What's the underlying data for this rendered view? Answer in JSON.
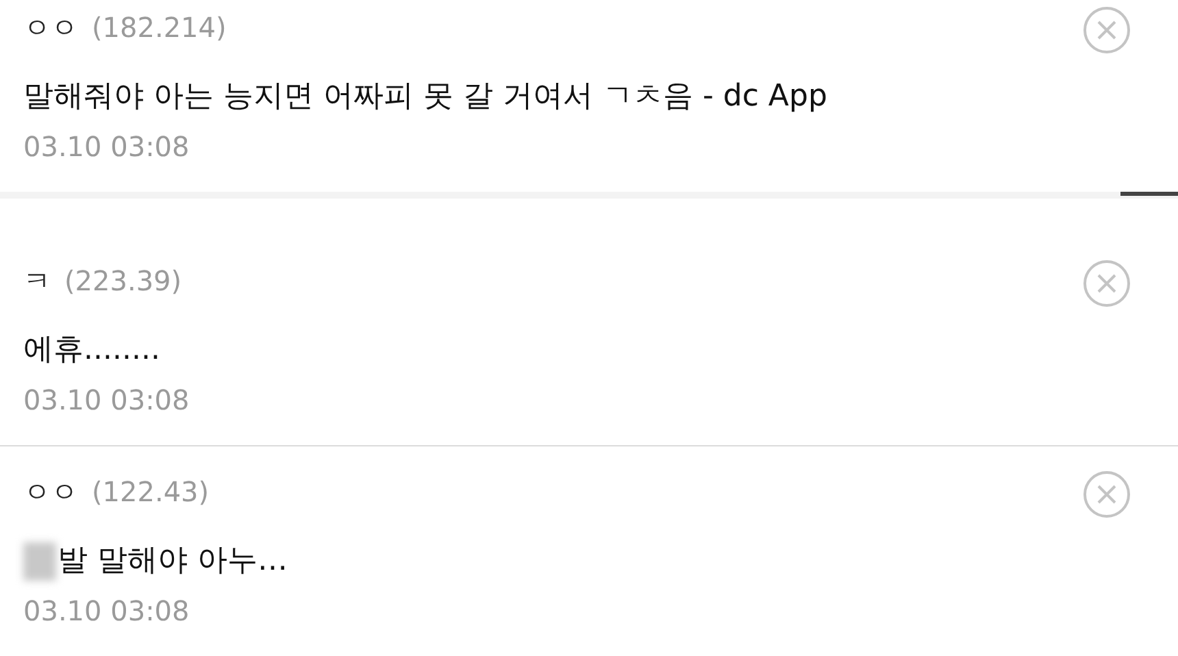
{
  "comments": [
    {
      "author": "ㅇㅇ",
      "ip": "(182.214)",
      "text": "말해줘야 아는 능지면 어짜피 못 갈 거여서 ㄱㅊ음 - dc App",
      "date": "03.10 03:08",
      "blurred_prefix": false
    },
    {
      "author": "ㅋ",
      "ip": "(223.39)",
      "text": "에휴........",
      "date": "03.10 03:08",
      "blurred_prefix": false
    },
    {
      "author": "ㅇㅇ",
      "ip": "(122.43)",
      "text": "발 말해야 아누…",
      "date": "03.10 03:08",
      "blurred_prefix": true
    }
  ]
}
